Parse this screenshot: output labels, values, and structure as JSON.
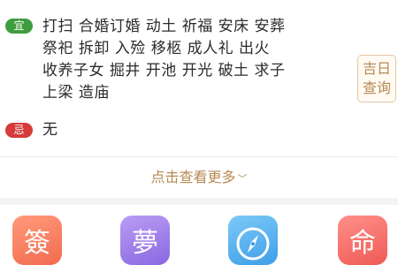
{
  "yi": {
    "badge": "宜",
    "lines": [
      "打扫  合婚订婚  动土  祈福  安床  安葬",
      "祭祀  拆卸  入殓  移柩  成人礼  出火",
      "收养子女  掘井  开池  开光  破土  求子",
      "上梁  造庙"
    ]
  },
  "ji": {
    "badge": "忌",
    "text": "无"
  },
  "jiri_button": {
    "line1": "吉日",
    "line2": "查询"
  },
  "more": {
    "label": "点击查看更多"
  },
  "apps": [
    {
      "glyph": "簽",
      "icon": "fortune-stick-icon"
    },
    {
      "glyph": "夢",
      "icon": "dream-icon"
    },
    {
      "glyph": "",
      "icon": "compass-icon"
    },
    {
      "glyph": "命",
      "icon": "destiny-icon"
    }
  ]
}
